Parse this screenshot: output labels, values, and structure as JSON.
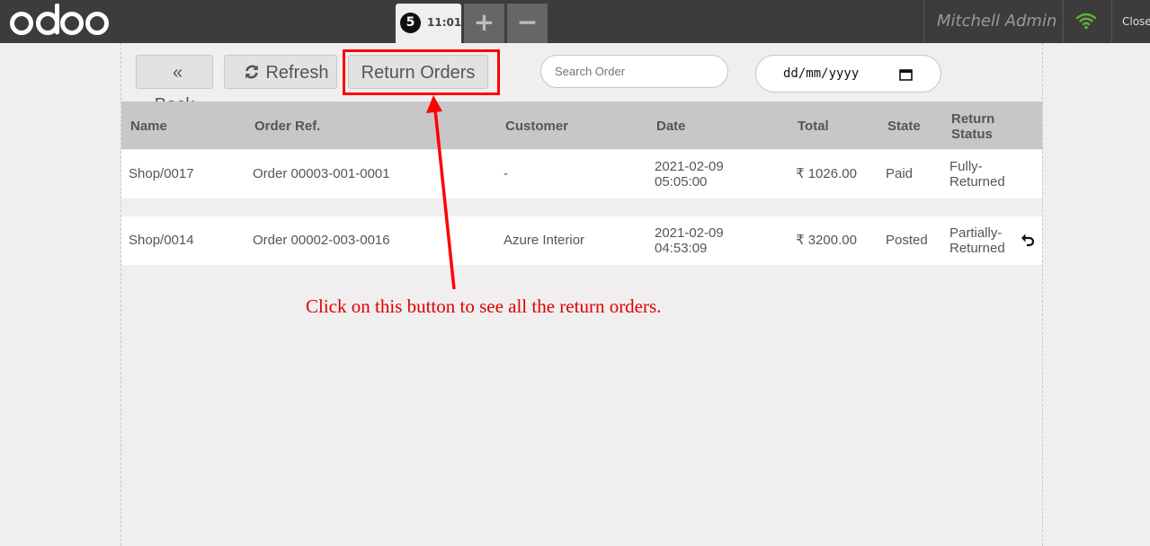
{
  "topbar": {
    "logo_text": "odoo",
    "order_tab": {
      "badge": "5",
      "time": "11:01"
    },
    "add_label": "+",
    "remove_label": "−",
    "user_name": "Mitchell Admin",
    "close_label": "Close",
    "wifi_color": "#5fb13a"
  },
  "controls": {
    "back_label": "Back",
    "refresh_label": "Refresh",
    "return_orders_label": "Return Orders",
    "search_placeholder": "Search Order",
    "date_placeholder": "dd/mm/yyyy"
  },
  "table": {
    "headers": {
      "name": "Name",
      "order_ref": "Order Ref.",
      "customer": "Customer",
      "date": "Date",
      "total": "Total",
      "state": "State",
      "return_status": [
        "Return",
        "Status"
      ]
    },
    "rows": [
      {
        "name": "Shop/0017",
        "order_ref": "Order 00003-001-0001",
        "customer": "-",
        "date": [
          "2021-02-09",
          "05:05:00"
        ],
        "total": "₹ 1026.00",
        "state": "Paid",
        "return_status": [
          "Fully-",
          "Returned"
        ],
        "has_return_icon": false
      },
      {
        "name": "Shop/0014",
        "order_ref": "Order 00002-003-0016",
        "customer": "Azure Interior",
        "date": [
          "2021-02-09",
          "04:53:09"
        ],
        "total": "₹ 3200.00",
        "state": "Posted",
        "return_status": [
          "Partially-",
          "Returned"
        ],
        "has_return_icon": true
      }
    ]
  },
  "annotation": {
    "text": "Click on this button to see all the return orders.",
    "color": "#e00000"
  }
}
